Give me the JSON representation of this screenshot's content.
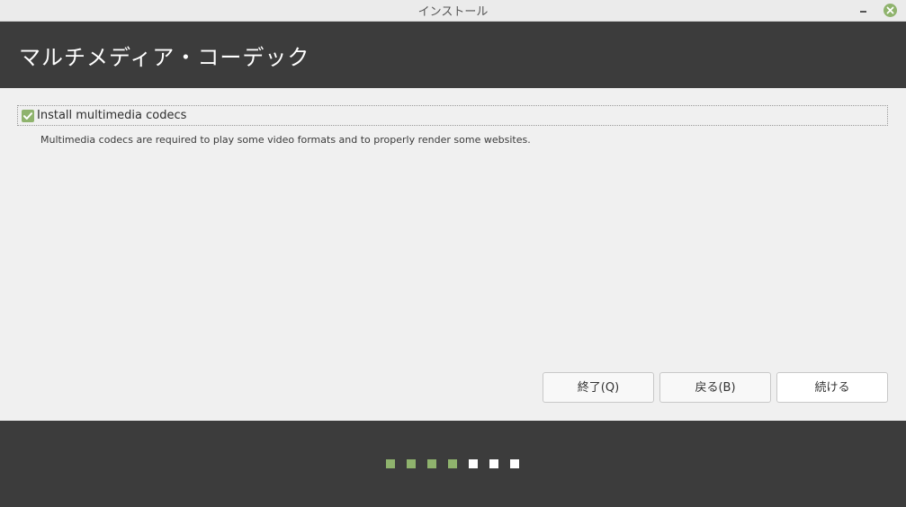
{
  "window": {
    "title": "インストール",
    "minimize_icon": "minimize-icon",
    "close_icon": "close-icon"
  },
  "header": {
    "title": "マルチメディア・コーデック"
  },
  "codecs": {
    "checkbox_label": "Install multimedia codecs",
    "checked": true,
    "description": "Multimedia codecs are required to play some video formats and to properly render some websites."
  },
  "buttons": {
    "quit": "終了(Q)",
    "back": "戻る(B)",
    "continue": "続ける"
  },
  "progress": {
    "total_steps": 7,
    "completed_steps": 4
  },
  "colors": {
    "accent": "#8fb36d",
    "header_bg": "#3c3c3c",
    "content_bg": "#f0f0f0"
  }
}
